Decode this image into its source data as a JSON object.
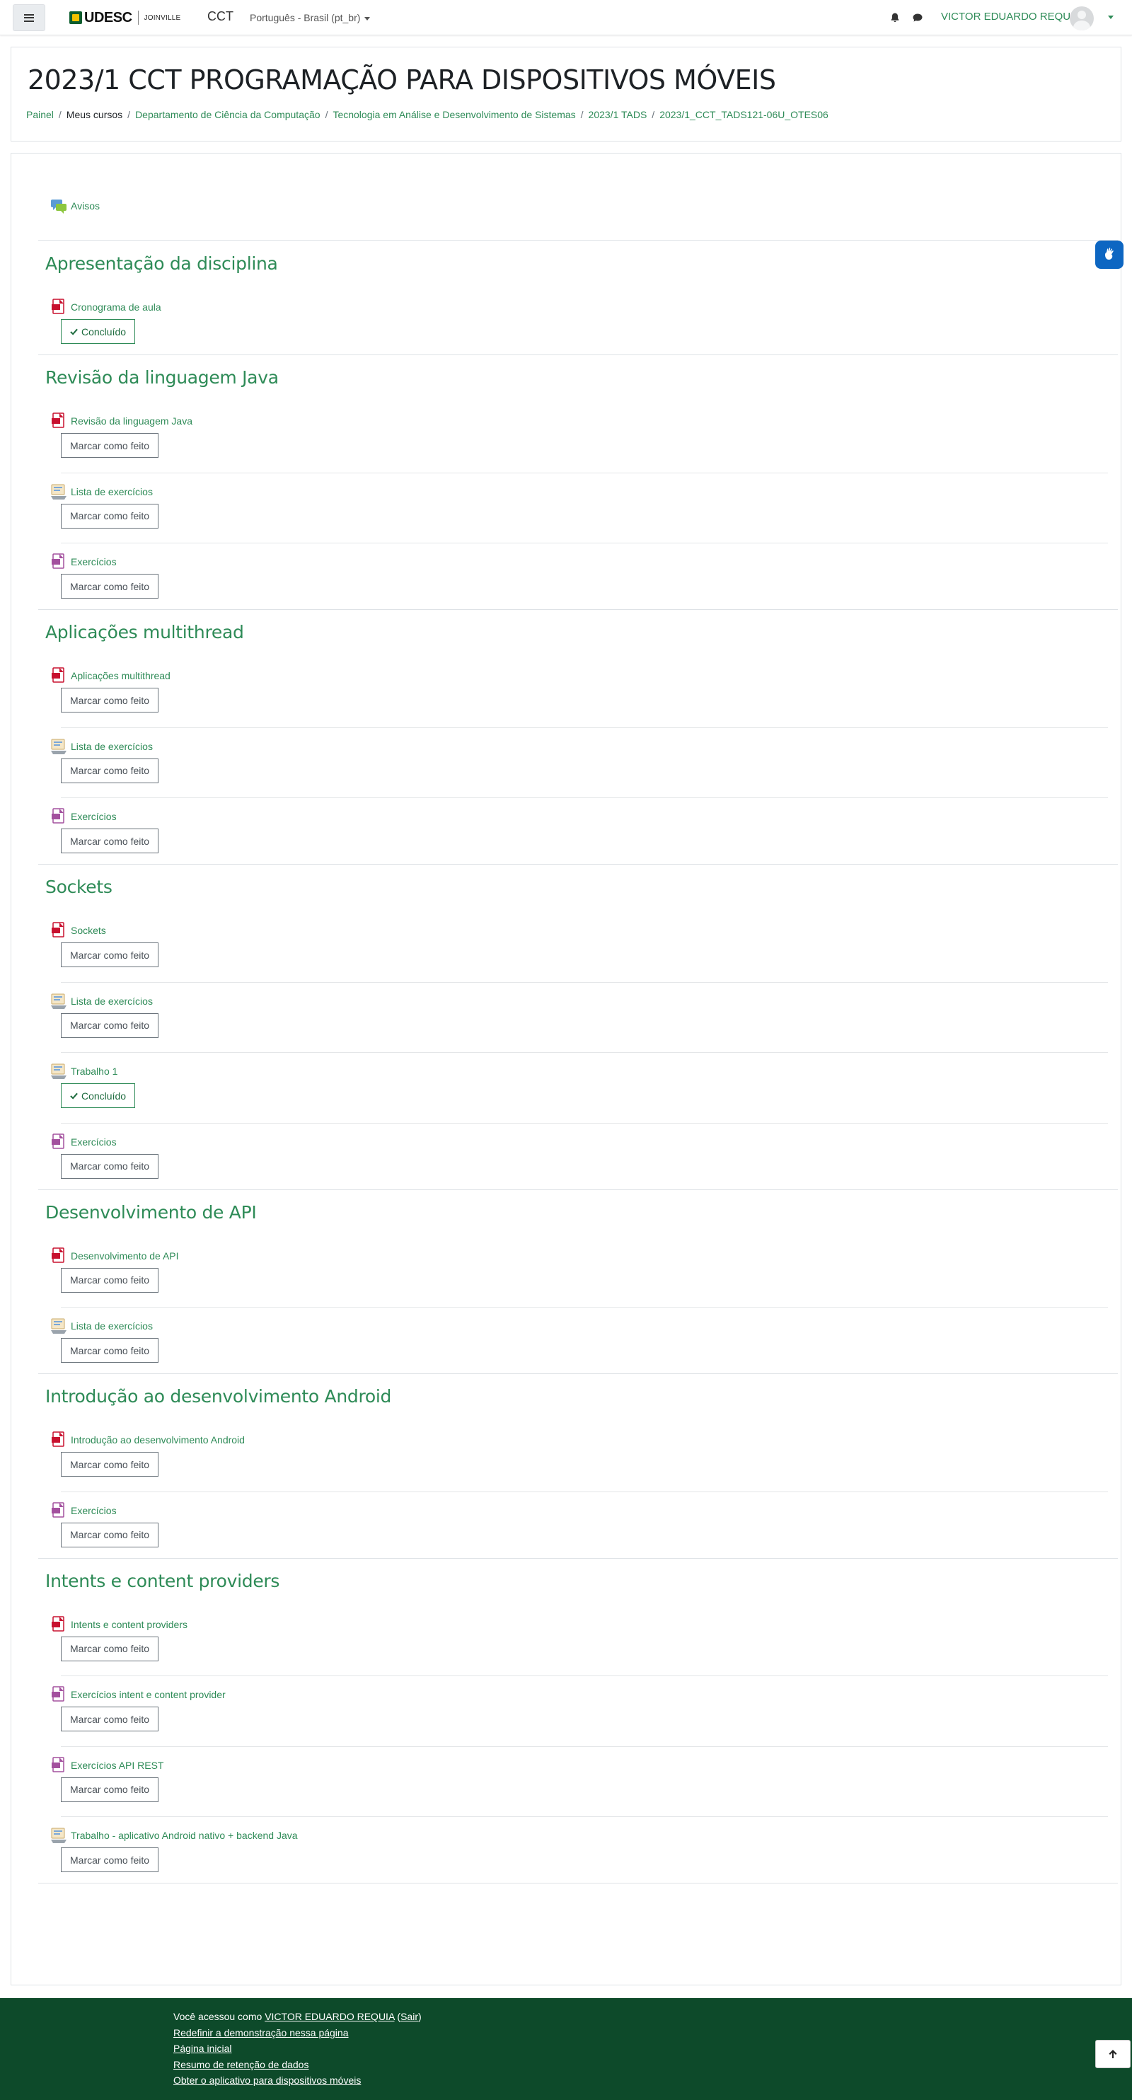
{
  "navbar": {
    "logo_text": "UDESC",
    "logo_sub": "JOINVILLE",
    "site_name": "CCT",
    "language": "Português - Brasil (pt_br)",
    "user_name": "VICTOR EDUARDO REQUIA"
  },
  "header": {
    "title": "2023/1 CCT PROGRAMAÇÃO PARA DISPOSITIVOS MÓVEIS",
    "breadcrumb": [
      "Painel",
      "Meus cursos",
      "Departamento de Ciência da Computação",
      "Tecnologia em Análise e Desenvolvimento de Sistemas",
      "2023/1 TADS",
      "2023/1_CCT_TADS121-06U_OTES06"
    ]
  },
  "announcements": {
    "label": "Avisos",
    "icon": "forum-icon"
  },
  "buttons": {
    "mark_done": "Marcar como feito",
    "done": "Concluído"
  },
  "sections": [
    {
      "title": "Apresentação da disciplina",
      "items": [
        {
          "label": "Cronograma de aula",
          "icon": "pdf-icon",
          "status": "Concluído"
        }
      ]
    },
    {
      "title": "Revisão da linguagem Java",
      "items": [
        {
          "label": "Revisão da linguagem Java",
          "icon": "pdf-icon",
          "status": "Marcar como feito"
        },
        {
          "label": "Lista de exercícios",
          "icon": "assignment-icon",
          "status": "Marcar como feito"
        },
        {
          "label": "Exercícios",
          "icon": "document-icon",
          "status": "Marcar como feito"
        }
      ]
    },
    {
      "title": "Aplicações multithread",
      "items": [
        {
          "label": "Aplicações multithread",
          "icon": "pdf-icon",
          "status": "Marcar como feito"
        },
        {
          "label": "Lista de exercícios",
          "icon": "assignment-icon",
          "status": "Marcar como feito"
        },
        {
          "label": "Exercícios",
          "icon": "document-icon",
          "status": "Marcar como feito"
        }
      ]
    },
    {
      "title": "Sockets",
      "items": [
        {
          "label": "Sockets",
          "icon": "pdf-icon",
          "status": "Marcar como feito"
        },
        {
          "label": "Lista de exercícios",
          "icon": "assignment-icon",
          "status": "Marcar como feito"
        },
        {
          "label": "Trabalho 1",
          "icon": "assignment-icon",
          "status": "Concluído"
        },
        {
          "label": "Exercícios",
          "icon": "document-icon",
          "status": "Marcar como feito"
        }
      ]
    },
    {
      "title": "Desenvolvimento de API",
      "items": [
        {
          "label": "Desenvolvimento de API",
          "icon": "pdf-icon",
          "status": "Marcar como feito"
        },
        {
          "label": "Lista de exercícios",
          "icon": "assignment-icon",
          "status": "Marcar como feito"
        }
      ]
    },
    {
      "title": "Introdução ao desenvolvimento Android",
      "items": [
        {
          "label": "Introdução ao desenvolvimento Android",
          "icon": "pdf-icon",
          "status": "Marcar como feito"
        },
        {
          "label": "Exercícios",
          "icon": "document-icon",
          "status": "Marcar como feito"
        }
      ]
    },
    {
      "title": "Intents e content providers",
      "items": [
        {
          "label": "Intents e content providers",
          "icon": "pdf-icon",
          "status": "Marcar como feito"
        },
        {
          "label": "Exercícios intent e content provider",
          "icon": "document-icon",
          "status": "Marcar como feito"
        },
        {
          "label": "Exercícios API REST",
          "icon": "document-icon",
          "status": "Marcar como feito"
        },
        {
          "label": "Trabalho - aplicativo Android nativo + backend Java",
          "icon": "assignment-icon",
          "status": "Marcar como feito"
        }
      ]
    }
  ],
  "footer": {
    "logged_in_prefix": "Você acessou como",
    "user_name": "VICTOR EDUARDO REQUIA",
    "logout": "Sair",
    "links": [
      "Redefinir a demonstração nessa página",
      "Página inicial",
      "Resumo de retenção de dados",
      "Obter o aplicativo para dispositivos móveis"
    ]
  },
  "colors": {
    "accent": "#2e8b57",
    "footer_bg": "#0d4a2a",
    "a11y_widget": "#0d66c2"
  }
}
